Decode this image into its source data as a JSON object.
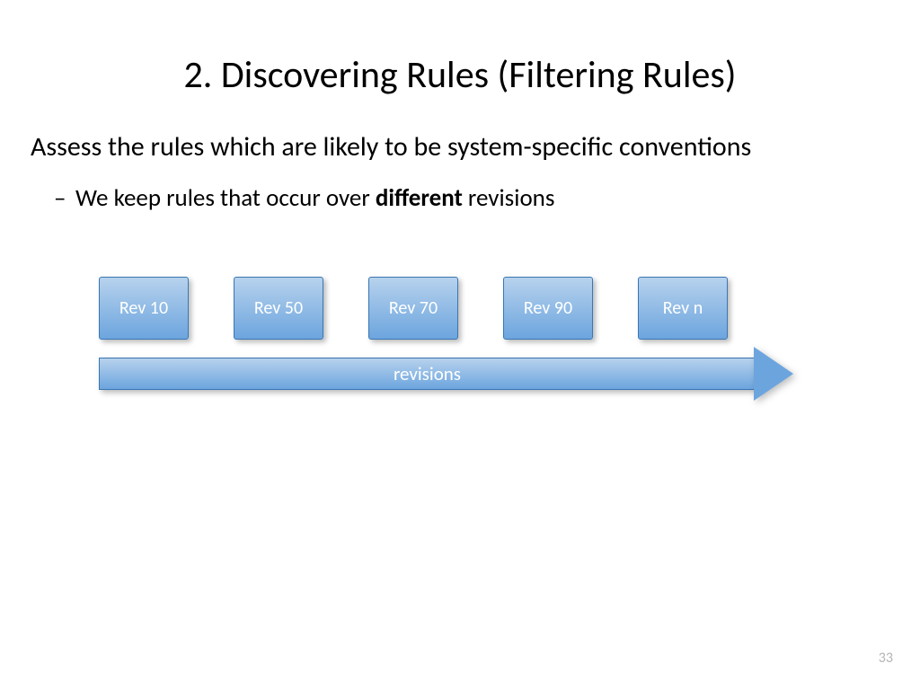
{
  "title": "2. Discovering Rules (Filtering Rules)",
  "body": "Assess the rules which are likely to be system-specific conventions",
  "bullet": {
    "pre": "We keep rules that occur over ",
    "bold": "different",
    "post": " revisions"
  },
  "boxes": [
    "Rev 10",
    "Rev 50",
    "Rev 70",
    "Rev 90",
    "Rev n"
  ],
  "arrowLabel": "revisions",
  "pageNumber": "33"
}
